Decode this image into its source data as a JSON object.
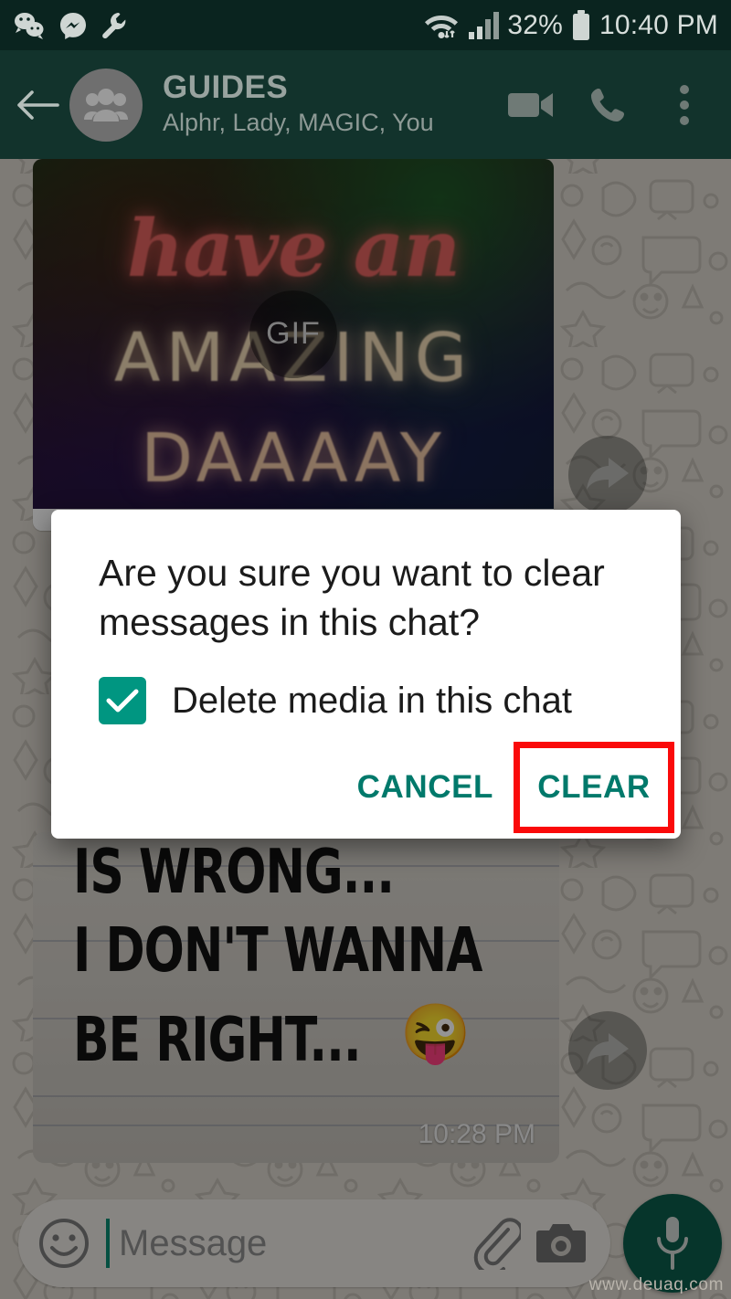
{
  "status_bar": {
    "left_icons": [
      "wechat-icon",
      "messenger-icon",
      "wrench-icon"
    ],
    "wifi_icon": "wifi-icon",
    "signal_icon": "cellular-signal-icon",
    "battery_percent": "32%",
    "battery_icon": "battery-icon",
    "time": "10:40 PM"
  },
  "app_bar": {
    "back_icon": "back-arrow-icon",
    "avatar_icon": "group-avatar-icon",
    "title": "GUIDES",
    "subtitle": "Alphr, Lady, MAGIC, You",
    "video_call_icon": "video-camera-icon",
    "voice_call_icon": "phone-icon",
    "overflow_icon": "more-vertical-icon"
  },
  "messages": [
    {
      "type": "gif",
      "badge": "GIF",
      "lines": [
        "have an",
        "AMAZING",
        "DAAAAY"
      ],
      "forward_icon": "forward-arrow-icon"
    },
    {
      "type": "image-note",
      "lines": [
        "IS WRONG...",
        "I DON'T WANNA",
        "BE RIGHT..."
      ],
      "emoji": "😜",
      "time": "10:28 PM",
      "forward_icon": "forward-arrow-icon"
    }
  ],
  "dialog": {
    "title": "Are you sure you want to clear messages in this chat?",
    "checkbox_label": "Delete media in this chat",
    "checkbox_checked": true,
    "cancel_label": "CANCEL",
    "clear_label": "CLEAR",
    "highlight_color": "#fa0a0a",
    "accent_color": "#00796b"
  },
  "composer": {
    "emoji_icon": "emoji-smiley-icon",
    "placeholder": "Message",
    "attach_icon": "paperclip-icon",
    "camera_icon": "camera-icon",
    "mic_icon": "microphone-icon"
  },
  "watermark": "www.deuaq.com",
  "colors": {
    "status_bar": "#0a241f",
    "app_bar": "#12332c",
    "accent_teal": "#00796b",
    "mic_green": "#0b5c4b"
  }
}
